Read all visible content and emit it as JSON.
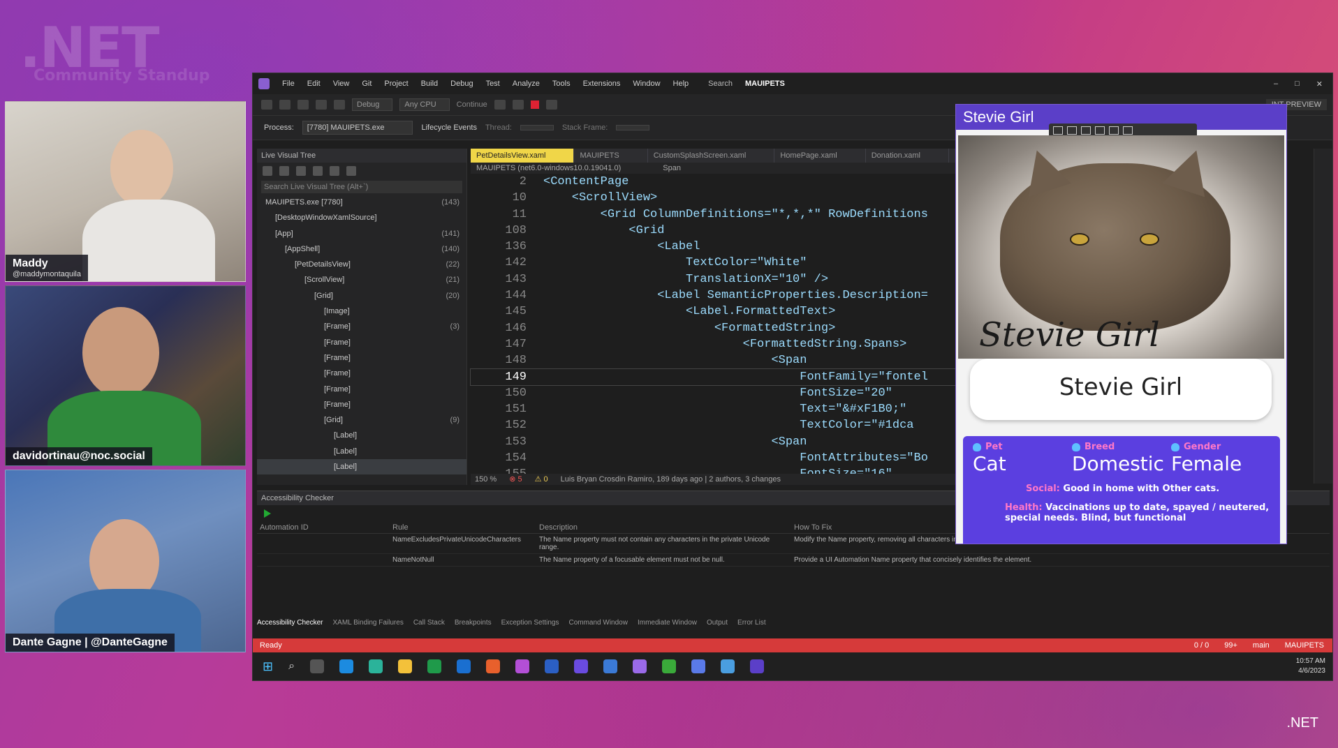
{
  "brand": {
    "logo": ".NET",
    "sub": "Community Standup",
    "corner": ".NET"
  },
  "hosts": [
    {
      "name": "Maddy",
      "handle": "@maddymontaquila"
    },
    {
      "name": "davidortinau@noc.social"
    },
    {
      "name": "Dante Gagne | @DanteGagne"
    }
  ],
  "vs": {
    "menu": [
      "File",
      "Edit",
      "View",
      "Git",
      "Project",
      "Build",
      "Debug",
      "Test",
      "Analyze",
      "Tools",
      "Extensions",
      "Window",
      "Help"
    ],
    "search": "Search",
    "title": "MAUIPETS",
    "toolbar": {
      "config": "Debug",
      "platform": "Any CPU",
      "continue": "Continue",
      "preview": "INT PREVIEW"
    },
    "process_label": "Process:",
    "process": "[7780] MAUIPETS.exe",
    "lifecycle": "Lifecycle Events",
    "thread": "Thread:",
    "stack_frame": "Stack Frame:",
    "live_tree": {
      "title": "Live Visual Tree",
      "search": "Search Live Visual Tree (Alt+`)",
      "rows": [
        {
          "indent": 0,
          "label": "MAUIPETS.exe [7780]",
          "count": "(143)"
        },
        {
          "indent": 1,
          "label": "[DesktopWindowXamlSource]",
          "count": ""
        },
        {
          "indent": 1,
          "label": "[App]",
          "count": "(141)"
        },
        {
          "indent": 2,
          "label": "[AppShell]",
          "count": "(140)"
        },
        {
          "indent": 3,
          "label": "[PetDetailsView]",
          "count": "(22)"
        },
        {
          "indent": 4,
          "label": "[ScrollView]",
          "count": "(21)"
        },
        {
          "indent": 5,
          "label": "[Grid]",
          "count": "(20)"
        },
        {
          "indent": 6,
          "label": "[Image]",
          "count": ""
        },
        {
          "indent": 6,
          "label": "[Frame]",
          "count": "(3)"
        },
        {
          "indent": 6,
          "label": "[Frame]",
          "count": ""
        },
        {
          "indent": 6,
          "label": "[Frame]",
          "count": ""
        },
        {
          "indent": 6,
          "label": "[Frame]",
          "count": ""
        },
        {
          "indent": 6,
          "label": "[Frame]",
          "count": ""
        },
        {
          "indent": 6,
          "label": "[Frame]",
          "count": ""
        },
        {
          "indent": 6,
          "label": "[Grid]",
          "count": "(9)"
        },
        {
          "indent": 7,
          "label": "[Label]",
          "count": ""
        },
        {
          "indent": 7,
          "label": "[Label]",
          "count": ""
        },
        {
          "indent": 7,
          "label": "[Label]",
          "count": ""
        }
      ]
    },
    "tabs": [
      "PetDetailsView.xaml",
      "MAUIPETS",
      "CustomSplashScreen.xaml",
      "HomePage.xaml",
      "Donation.xaml"
    ],
    "nav_left": "MAUIPETS (net6.0-windows10.0.19041.0)",
    "nav_right": "Span",
    "code": [
      {
        "n": "2",
        "t": "<ContentPage"
      },
      {
        "n": "10",
        "t": "    <ScrollView>"
      },
      {
        "n": "11",
        "t": "        <Grid ColumnDefinitions=\"*,*,*\" RowDefinitions"
      },
      {
        "n": "108",
        "t": "            <Grid"
      },
      {
        "n": "136",
        "t": "                <Label"
      },
      {
        "n": "142",
        "t": "                    TextColor=\"White\""
      },
      {
        "n": "143",
        "t": "                    TranslationX=\"10\" />"
      },
      {
        "n": "144",
        "t": "                <Label SemanticProperties.Description="
      },
      {
        "n": "145",
        "t": "                    <Label.FormattedText>"
      },
      {
        "n": "146",
        "t": "                        <FormattedString>"
      },
      {
        "n": "147",
        "t": "                            <FormattedString.Spans>"
      },
      {
        "n": "148",
        "t": "                                <Span"
      },
      {
        "n": "149",
        "t": "                                    FontFamily=\"fontel"
      },
      {
        "n": "150",
        "t": "                                    FontSize=\"20\""
      },
      {
        "n": "151",
        "t": "                                    Text=\"&#xF1B0;\""
      },
      {
        "n": "152",
        "t": "                                    TextColor=\"#1dca"
      },
      {
        "n": "153",
        "t": "                                <Span"
      },
      {
        "n": "154",
        "t": "                                    FontAttributes=\"Bo"
      },
      {
        "n": "155",
        "t": "                                    FontSize=\"16\""
      }
    ],
    "editor_status": {
      "zoom": "150 %",
      "errors": "5",
      "warnings": "0",
      "git": "Luis Bryan Crosdin Ramiro, 189 days ago | 2 authors, 3 changes"
    },
    "accessibility": {
      "title": "Accessibility Checker",
      "headers": [
        "Automation ID",
        "Rule",
        "Description",
        "How To Fix"
      ],
      "rows": [
        {
          "id": "",
          "rule": "NameExcludesPrivateUnicodeCharacters",
          "desc": "The Name property must not contain any characters in the private Unicode range.",
          "fix": "Modify the Name property, removing all characters in the range U+E000 to U+F8FF and replace them with meaningful standard text content."
        },
        {
          "id": "",
          "rule": "NameNotNull",
          "desc": "The Name property of a focusable element must not be null.",
          "fix": "Provide a UI Automation Name property that concisely identifies the element."
        }
      ]
    },
    "bottom_tabs": [
      "Accessibility Checker",
      "XAML Binding Failures",
      "Call Stack",
      "Breakpoints",
      "Exception Settings",
      "Command Window",
      "Immediate Window",
      "Output",
      "Error List"
    ],
    "status": {
      "ready": "Ready",
      "lines": "0 / 0",
      "changes": "99+",
      "branch": "main",
      "repo": "MAUIPETS"
    },
    "clock": {
      "time": "10:57 AM",
      "date": "4/6/2023"
    }
  },
  "app": {
    "title": "Stevie Girl",
    "photo_caption": "Stevie Girl",
    "name": "Stevie Girl",
    "labels": {
      "pet": "Pet",
      "breed": "Breed",
      "gender": "Gender"
    },
    "values": {
      "pet": "Cat",
      "breed": "Domestic",
      "gender": "Female"
    },
    "social_label": "Social:",
    "social": "Good in home with Other cats.",
    "health_label": "Health:",
    "health": "Vaccinations up to date, spayed / neutered, special needs. Blind, but functional"
  },
  "colors": {
    "accent": "#5b3fc8",
    "status_bar": "#d63a3a",
    "active_tab": "#f0d648",
    "pet_label": "#ff78c8"
  }
}
